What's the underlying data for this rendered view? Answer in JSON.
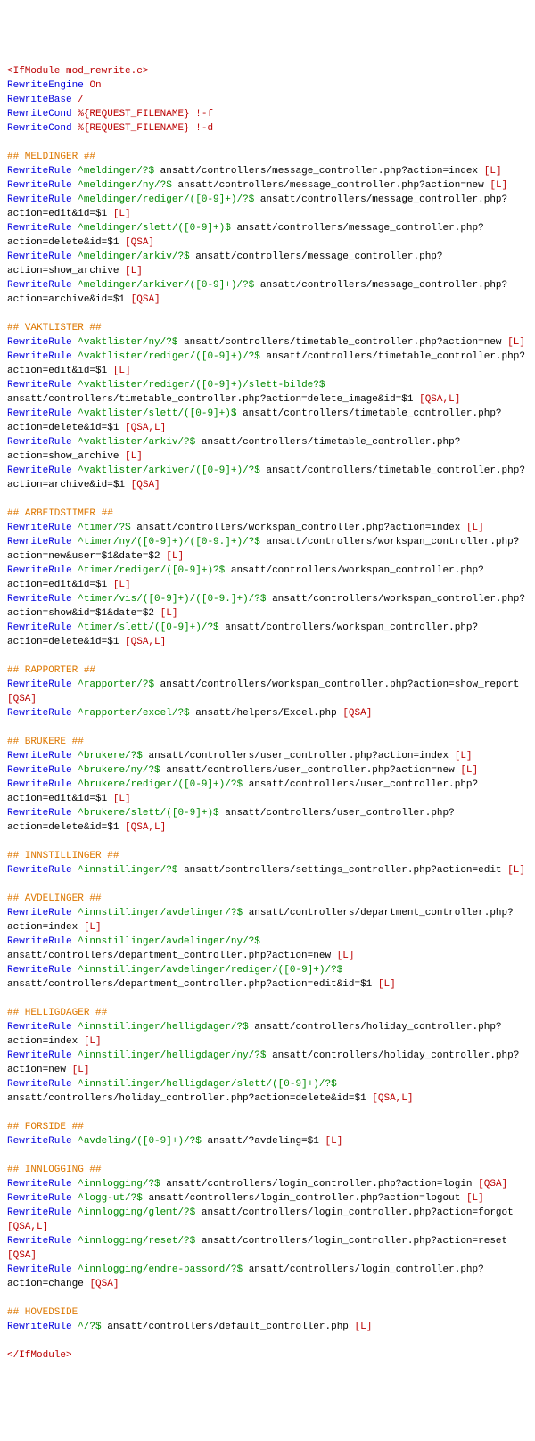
{
  "lines": [
    {
      "t": "tag",
      "v": "<IfModule mod_rewrite.c>"
    },
    {
      "t": "de",
      "d": "RewriteEngine",
      "a": "On"
    },
    {
      "t": "de",
      "d": "RewriteBase",
      "a": "/"
    },
    {
      "t": "de",
      "d": "RewriteCond",
      "a": "%{REQUEST_FILENAME} !-f"
    },
    {
      "t": "de",
      "d": "RewriteCond",
      "a": "%{REQUEST_FILENAME} !-d"
    },
    {
      "t": "b"
    },
    {
      "t": "c",
      "v": "## MELDINGER ##"
    },
    {
      "t": "r",
      "p": "^meldinger/?$",
      "r": "ansatt/controllers/message_controller.php?action=index",
      "f": "[L]"
    },
    {
      "t": "r",
      "p": "^meldinger/ny/?$",
      "r": "ansatt/controllers/message_controller.php?action=new",
      "f": "[L]"
    },
    {
      "t": "r",
      "p": "^meldinger/rediger/([0-9]+)/?$",
      "r": "ansatt/controllers/message_controller.php?action=edit&id=$1",
      "f": "[L]"
    },
    {
      "t": "r",
      "p": "^meldinger/slett/([0-9]+)$",
      "r": "ansatt/controllers/message_controller.php?action=delete&id=$1",
      "f": "[QSA]"
    },
    {
      "t": "r",
      "p": "^meldinger/arkiv/?$",
      "r": "ansatt/controllers/message_controller.php?action=show_archive",
      "f": "[L]"
    },
    {
      "t": "r",
      "p": "^meldinger/arkiver/([0-9]+)/?$",
      "r": "ansatt/controllers/message_controller.php?action=archive&id=$1",
      "f": "[QSA]"
    },
    {
      "t": "b"
    },
    {
      "t": "c",
      "v": "## VAKTLISTER ##"
    },
    {
      "t": "r",
      "p": "^vaktlister/ny/?$",
      "r": "ansatt/controllers/timetable_controller.php?action=new",
      "f": "[L]"
    },
    {
      "t": "r",
      "p": "^vaktlister/rediger/([0-9]+)/?$",
      "r": "ansatt/controllers/timetable_controller.php?action=edit&id=$1",
      "f": "[L]"
    },
    {
      "t": "r",
      "p": "^vaktlister/rediger/([0-9]+)/slett-bilde?$",
      "r": "ansatt/controllers/timetable_controller.php?action=delete_image&id=$1",
      "f": "[QSA,L]"
    },
    {
      "t": "r",
      "p": "^vaktlister/slett/([0-9]+)$",
      "r": "ansatt/controllers/timetable_controller.php?action=delete&id=$1",
      "f": "[QSA,L]"
    },
    {
      "t": "r",
      "p": "^vaktlister/arkiv/?$",
      "r": "ansatt/controllers/timetable_controller.php?action=show_archive",
      "f": "[L]"
    },
    {
      "t": "r",
      "p": "^vaktlister/arkiver/([0-9]+)/?$",
      "r": "ansatt/controllers/timetable_controller.php?action=archive&id=$1",
      "f": "[QSA]"
    },
    {
      "t": "b"
    },
    {
      "t": "c",
      "v": "## ARBEIDSTIMER ##"
    },
    {
      "t": "r",
      "p": "^timer/?$",
      "r": "ansatt/controllers/workspan_controller.php?action=index",
      "f": "[L]"
    },
    {
      "t": "r",
      "p": "^timer/ny/([0-9]+)/([0-9.]+)/?$",
      "r": "ansatt/controllers/workspan_controller.php?action=new&user=$1&date=$2",
      "f": "[L]"
    },
    {
      "t": "r",
      "p": "^timer/rediger/([0-9]+)?$",
      "r": "ansatt/controllers/workspan_controller.php?action=edit&id=$1",
      "f": "[L]"
    },
    {
      "t": "r",
      "p": "^timer/vis/([0-9]+)/([0-9.]+)/?$",
      "r": "ansatt/controllers/workspan_controller.php?action=show&id=$1&date=$2",
      "f": "[L]"
    },
    {
      "t": "r",
      "p": "^timer/slett/([0-9]+)/?$",
      "r": "ansatt/controllers/workspan_controller.php?action=delete&id=$1",
      "f": "[QSA,L]"
    },
    {
      "t": "b"
    },
    {
      "t": "c",
      "v": "## RAPPORTER ##"
    },
    {
      "t": "r",
      "p": "^rapporter/?$",
      "r": "ansatt/controllers/workspan_controller.php?action=show_report",
      "f": "[QSA]"
    },
    {
      "t": "r",
      "p": "^rapporter/excel/?$",
      "r": "ansatt/helpers/Excel.php",
      "f": "[QSA]"
    },
    {
      "t": "b"
    },
    {
      "t": "c",
      "v": "## BRUKERE ##"
    },
    {
      "t": "r",
      "p": "^brukere/?$",
      "r": "ansatt/controllers/user_controller.php?action=index",
      "f": "[L]"
    },
    {
      "t": "r",
      "p": "^brukere/ny/?$",
      "r": "ansatt/controllers/user_controller.php?action=new",
      "f": "[L]"
    },
    {
      "t": "r",
      "p": "^brukere/rediger/([0-9]+)/?$",
      "r": "ansatt/controllers/user_controller.php?action=edit&id=$1",
      "f": "[L]"
    },
    {
      "t": "r",
      "p": "^brukere/slett/([0-9]+)$",
      "r": "ansatt/controllers/user_controller.php?action=delete&id=$1",
      "f": "[QSA,L]"
    },
    {
      "t": "b"
    },
    {
      "t": "c",
      "v": "## INNSTILLINGER ##"
    },
    {
      "t": "r",
      "p": "^innstillinger/?$",
      "r": "ansatt/controllers/settings_controller.php?action=edit",
      "f": "[L]"
    },
    {
      "t": "b"
    },
    {
      "t": "c",
      "v": "## AVDELINGER ##"
    },
    {
      "t": "r",
      "p": "^innstillinger/avdelinger/?$",
      "r": "ansatt/controllers/department_controller.php?action=index",
      "f": "[L]"
    },
    {
      "t": "r",
      "p": "^innstillinger/avdelinger/ny/?$",
      "r": "ansatt/controllers/department_controller.php?action=new",
      "f": "[L]"
    },
    {
      "t": "r",
      "p": "^innstillinger/avdelinger/rediger/([0-9]+)/?$",
      "r": "ansatt/controllers/department_controller.php?action=edit&id=$1",
      "f": "[L]"
    },
    {
      "t": "b"
    },
    {
      "t": "c",
      "v": "## HELLIGDAGER ##"
    },
    {
      "t": "r",
      "p": "^innstillinger/helligdager/?$",
      "r": "ansatt/controllers/holiday_controller.php?action=index",
      "f": "[L]"
    },
    {
      "t": "r",
      "p": "^innstillinger/helligdager/ny/?$",
      "r": "ansatt/controllers/holiday_controller.php?action=new",
      "f": "[L]"
    },
    {
      "t": "r",
      "p": "^innstillinger/helligdager/slett/([0-9]+)/?$",
      "r": "ansatt/controllers/holiday_controller.php?action=delete&id=$1",
      "f": "[QSA,L]"
    },
    {
      "t": "b"
    },
    {
      "t": "c",
      "v": "## FORSIDE ##"
    },
    {
      "t": "r",
      "p": "^avdeling/([0-9]+)/?$",
      "r": "ansatt/?avdeling=$1",
      "f": "[L]"
    },
    {
      "t": "b"
    },
    {
      "t": "c",
      "v": "## INNLOGGING ##"
    },
    {
      "t": "r",
      "p": "^innlogging/?$",
      "r": "ansatt/controllers/login_controller.php?action=login",
      "f": "[QSA]"
    },
    {
      "t": "r",
      "p": "^logg-ut/?$",
      "r": "ansatt/controllers/login_controller.php?action=logout",
      "f": "[L]"
    },
    {
      "t": "r",
      "p": "^innlogging/glemt/?$",
      "r": "ansatt/controllers/login_controller.php?action=forgot",
      "f": "[QSA,L]"
    },
    {
      "t": "r",
      "p": "^innlogging/reset/?$",
      "r": "ansatt/controllers/login_controller.php?action=reset",
      "f": "[QSA]"
    },
    {
      "t": "r",
      "p": "^innlogging/endre-passord/?$",
      "r": "ansatt/controllers/login_controller.php?action=change",
      "f": "[QSA]"
    },
    {
      "t": "b"
    },
    {
      "t": "c",
      "v": "## HOVEDSIDE"
    },
    {
      "t": "r",
      "p": "^/?$",
      "r": "ansatt/controllers/default_controller.php",
      "f": "[L]"
    },
    {
      "t": "b"
    },
    {
      "t": "tag",
      "v": "</IfModule>"
    }
  ]
}
